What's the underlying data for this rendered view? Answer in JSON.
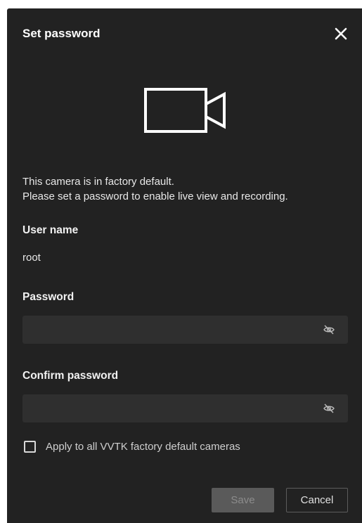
{
  "dialog": {
    "title": "Set password",
    "message_line1": "This camera is in factory default.",
    "message_line2": "Please set a password to enable live view and recording.",
    "username_label": "User name",
    "username_value": "root",
    "password_label": "Password",
    "password_value": "",
    "confirm_label": "Confirm password",
    "confirm_value": "",
    "apply_all_label": "Apply to all VVTK factory default cameras",
    "apply_all_checked": false,
    "save_label": "Save",
    "cancel_label": "Cancel"
  },
  "icons": {
    "close": "close-icon",
    "camera": "video-camera-icon",
    "password_visibility": "eye-off-icon",
    "confirm_visibility": "eye-off-icon"
  },
  "colors": {
    "dialog_background": "#222222",
    "input_background": "#2f2f2f",
    "save_disabled_background": "#5a5a5a"
  }
}
